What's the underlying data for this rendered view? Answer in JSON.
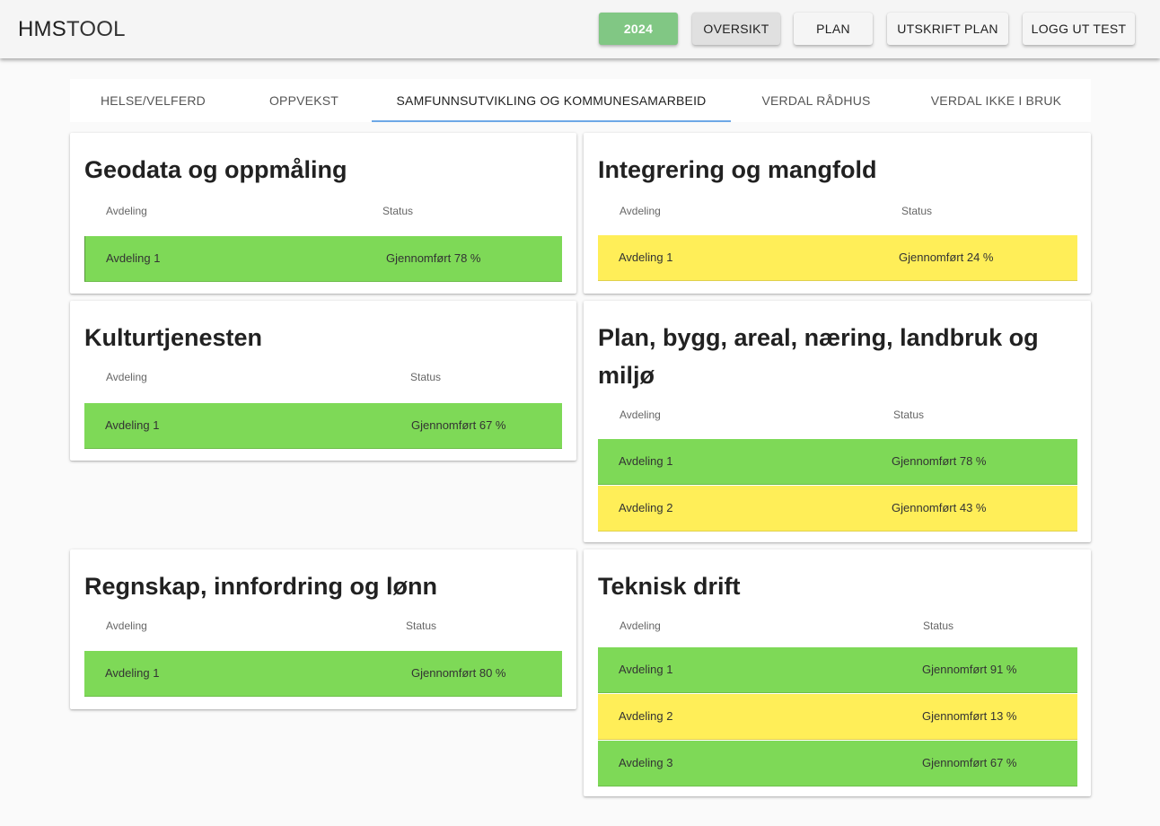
{
  "app": {
    "logo_bold": "HMS",
    "logo_light": "TOOL"
  },
  "toolbar": {
    "year": "2024",
    "overview": "OVERSIKT",
    "plan": "PLAN",
    "print_plan": "UTSKRIFT PLAN",
    "logout": "LOGG UT TEST"
  },
  "tabs": [
    {
      "label": "HELSE/VELFERD",
      "selected": false
    },
    {
      "label": "OPPVEKST",
      "selected": false
    },
    {
      "label": "SAMFUNNSUTVIKLING OG KOMMUNESAMARBEID",
      "selected": true
    },
    {
      "label": "VERDAL RÅDHUS",
      "selected": false
    },
    {
      "label": "VERDAL IKKE I BRUK",
      "selected": false
    }
  ],
  "table_headers": {
    "department": "Avdeling",
    "status": "Status"
  },
  "status_colors": {
    "green": "#7ed957",
    "yellow": "#ffee58"
  },
  "cards": [
    {
      "title": "Geodata og oppmåling",
      "rows": [
        {
          "department": "Avdeling 1",
          "status": "Gjennomført  78 %",
          "color": "green"
        }
      ]
    },
    {
      "title": "Integrering og mangfold",
      "rows": [
        {
          "department": "Avdeling 1",
          "status": "Gjennomført  24 %",
          "color": "yellow"
        }
      ]
    },
    {
      "title": "Kulturtjenesten",
      "rows": [
        {
          "department": "Avdeling 1",
          "status": "Gjennomført  67 %",
          "color": "green"
        }
      ]
    },
    {
      "title": "Plan, bygg, areal, næring, landbruk og miljø",
      "rows": [
        {
          "department": "Avdeling 1",
          "status": "Gjennomført  78 %",
          "color": "green"
        },
        {
          "department": "Avdeling 2",
          "status": "Gjennomført  43 %",
          "color": "yellow"
        }
      ]
    },
    {
      "title": "Regnskap, innfordring og lønn",
      "rows": [
        {
          "department": "Avdeling 1",
          "status": "Gjennomført  80 %",
          "color": "green"
        }
      ]
    },
    {
      "title": "Teknisk drift",
      "rows": [
        {
          "department": "Avdeling 1",
          "status": "Gjennomført  91 %",
          "color": "green"
        },
        {
          "department": "Avdeling 2",
          "status": "Gjennomført  13 %",
          "color": "yellow"
        },
        {
          "department": "Avdeling 3",
          "status": "Gjennomført  67 %",
          "color": "green"
        }
      ]
    }
  ]
}
